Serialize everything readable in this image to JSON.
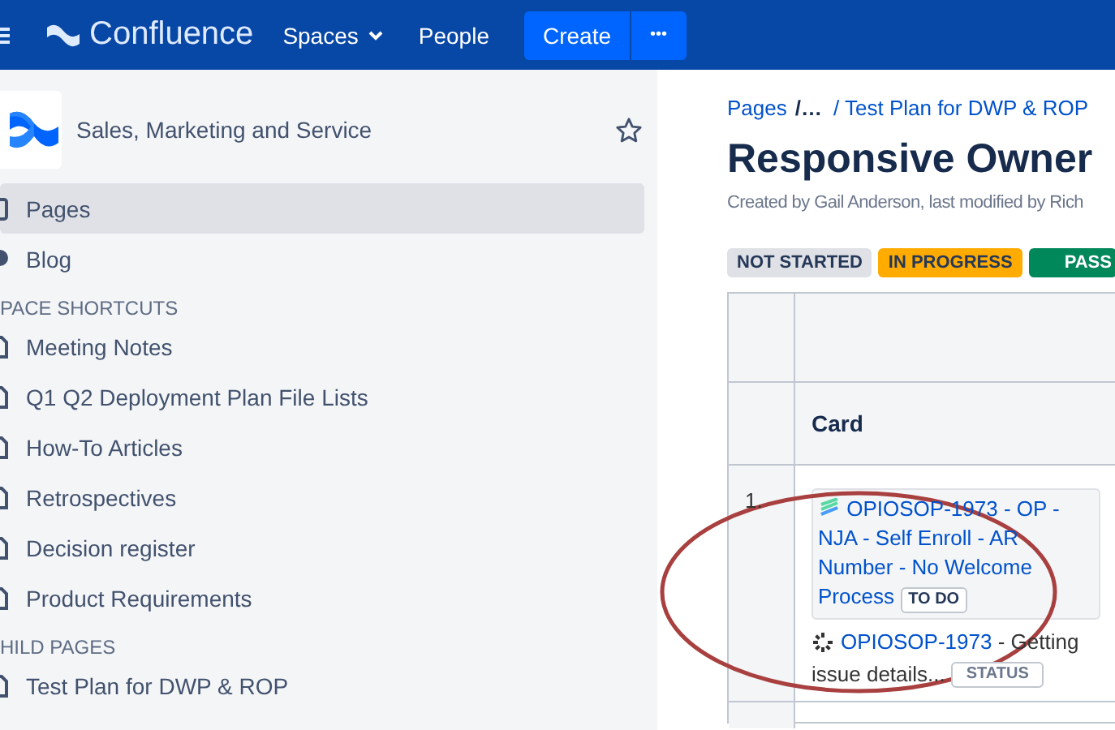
{
  "top_bar": {
    "product": "Confluence",
    "nav": [
      {
        "label": "Spaces",
        "dropdown": true
      },
      {
        "label": "People",
        "dropdown": false
      }
    ],
    "create": "Create",
    "more": "•••"
  },
  "sidebar": {
    "space_name": "Sales, Marketing and Service",
    "starred": false,
    "items": [
      {
        "label": "Pages",
        "kind": "pages",
        "selected": true
      },
      {
        "label": "Blog",
        "kind": "blog",
        "selected": false
      }
    ],
    "sections": [
      {
        "heading": "PACE SHORTCUTS",
        "items": [
          "Meeting Notes",
          "Q1 Q2 Deployment Plan File Lists",
          "How-To Articles",
          "Retrospectives",
          "Decision register",
          "Product Requirements"
        ]
      },
      {
        "heading": "HILD PAGES",
        "items": [
          "Test Plan for DWP & ROP"
        ]
      }
    ]
  },
  "breadcrumbs": [
    "Pages",
    "/…",
    "/ Test Plan for DWP & ROP"
  ],
  "page": {
    "title": "Responsive Owner",
    "byline": "Created by Gail Anderson, last modified by Rich",
    "statuses": [
      {
        "label": "NOT STARTED",
        "color": "#dfe1e6"
      },
      {
        "label": "IN PROGRESS",
        "color": "#ffab00"
      },
      {
        "label": "PASS",
        "color": "#00875a"
      }
    ],
    "table": {
      "columns": [
        "",
        "Card"
      ],
      "rows": [
        {
          "number": "1.",
          "issue": {
            "key": "OPIOSOP-1973 - OP - NJA - Self Enroll - AR Number - No Welcome Process",
            "status": "TO DO"
          },
          "loading": {
            "key": "OPIOSOP-1973",
            "text": "- Getting",
            "text_continued": "issue details...",
            "status": "STATUS"
          }
        }
      ]
    }
  }
}
